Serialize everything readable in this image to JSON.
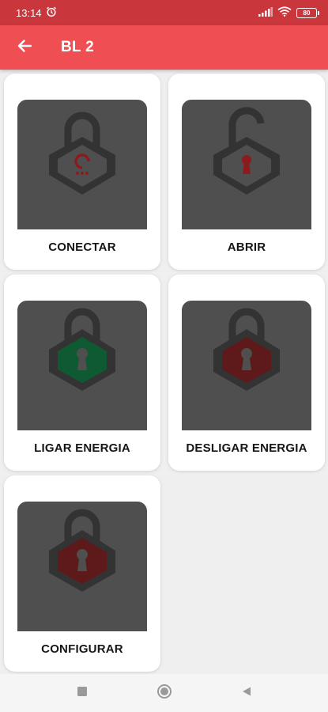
{
  "status_bar": {
    "time": "13:14",
    "battery": "80"
  },
  "app_bar": {
    "title": "BL 2"
  },
  "actions": [
    {
      "label": "CONECTAR",
      "icon": "connect-lock-icon"
    },
    {
      "label": "ABRIR",
      "icon": "open-lock-icon"
    },
    {
      "label": "LIGAR ENERGIA",
      "icon": "power-on-lock-icon"
    },
    {
      "label": "DESLIGAR ENERGIA",
      "icon": "power-off-lock-icon"
    },
    {
      "label": "CONFIGURAR",
      "icon": "configure-lock-icon"
    }
  ],
  "colors": {
    "status_bar": "#c9373d",
    "app_bar": "#ef4e52",
    "tile": "#4f4f4f",
    "lock_dark": "#333333",
    "keyhole_red": "#8c1b1f",
    "green": "#0f5a32",
    "red_fill": "#5e1a1a"
  }
}
